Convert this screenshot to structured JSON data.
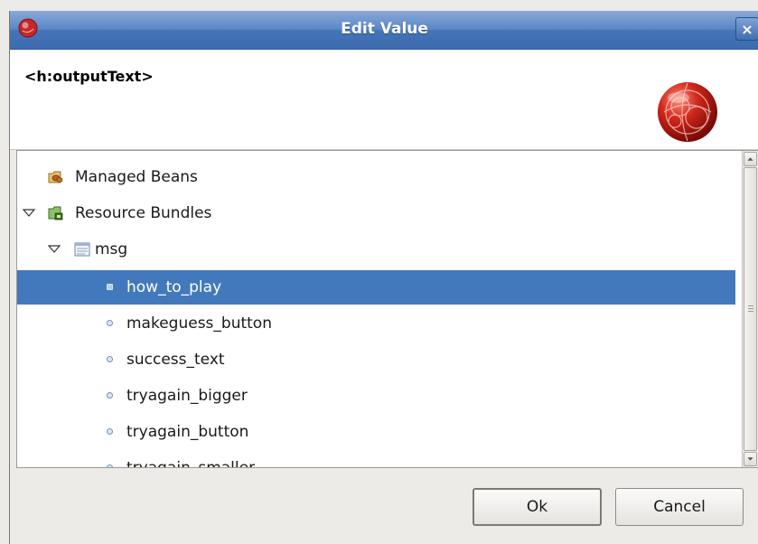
{
  "window": {
    "title": "Edit Value",
    "close_symbol": "×"
  },
  "header": {
    "title": "<h:outputText>",
    "logo_icon": "jsf-globe-logo"
  },
  "tree": {
    "items": [
      {
        "label": "Managed Beans",
        "icon": "beans-folder-icon",
        "expanded": null,
        "level": 0
      },
      {
        "label": "Resource Bundles",
        "icon": "bundles-folder-icon",
        "expanded": true,
        "level": 0
      },
      {
        "label": "msg",
        "icon": "properties-file-icon",
        "expanded": true,
        "level": 1
      },
      {
        "label": "how_to_play",
        "icon": "bullet-icon",
        "selected": true,
        "level": 2
      },
      {
        "label": "makeguess_button",
        "icon": "bullet-icon",
        "level": 2
      },
      {
        "label": "success_text",
        "icon": "bullet-icon",
        "level": 2
      },
      {
        "label": "tryagain_bigger",
        "icon": "bullet-icon",
        "level": 2
      },
      {
        "label": "tryagain_button",
        "icon": "bullet-icon",
        "level": 2
      },
      {
        "label": "tryagain_smaller",
        "icon": "bullet-icon",
        "level": 2
      }
    ]
  },
  "buttons": {
    "ok_label": "Ok",
    "cancel_label": "Cancel"
  },
  "colors": {
    "selection": "#4279bd",
    "titlebar": "#4474b8"
  }
}
